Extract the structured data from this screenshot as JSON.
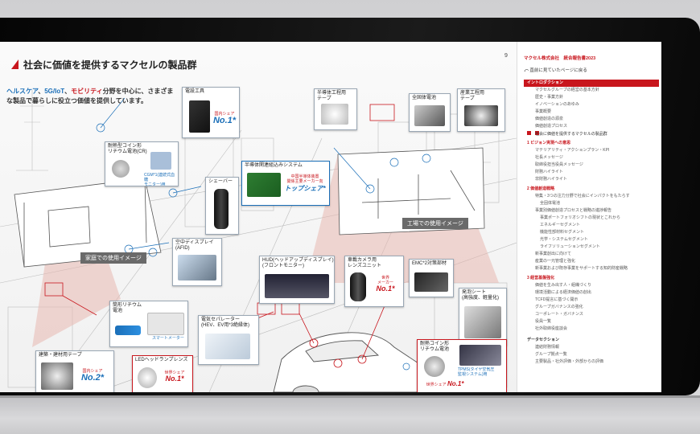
{
  "document": {
    "title": "社会に価値を提供するマクセルの製品群",
    "page_number": "9",
    "lead_before": "",
    "lead_hl1": "ヘルスケア",
    "lead_sep1": "、",
    "lead_hl2": "5G/IoT",
    "lead_sep2": "、",
    "lead_hl3": "モビリティ",
    "lead_after": "分野を中心に、さまざまな製品で暮らしに役立つ価値を提供しています。"
  },
  "labels": {
    "home": "家庭での使用イメージ",
    "factory": "工場での使用イメージ"
  },
  "products": {
    "drill": {
      "title": "電設工具",
      "share": "国内シェア",
      "rank": "No.1",
      "sup": "*"
    },
    "coin": {
      "title": "耐熱型コイン形\nリチウム電池(CR)",
      "note": "CGM*1(連続式血糖\nモニター)用"
    },
    "shaver": {
      "title": "シェーバー"
    },
    "semi_embed": {
      "title": "半導体関連組込みシステム",
      "share": "中国半導体装置\n関係主要メーカー向",
      "rank": "トップシェア",
      "sup": "*"
    },
    "semi_tape": {
      "title": "半導体工程用\nテープ"
    },
    "solid": {
      "title": "全固体電池"
    },
    "industrial_tape": {
      "title": "産業工程用\nテープ"
    },
    "aerial": {
      "title": "空中ディスプレイ\n(AFID)"
    },
    "hud": {
      "title": "HUD(ヘッドアップディスプレイ)\n(フロントモニター)"
    },
    "camera": {
      "title": "車載カメラ用\nレンズユニット",
      "share": "世界\nメーカー",
      "rank": "No.1",
      "sup": "*"
    },
    "emc": {
      "title": "EMC*2対策部材"
    },
    "cylinder": {
      "title": "筒形リチウム\n電池",
      "meter": "スマートメーター"
    },
    "heat_sheet": {
      "title": "発泡シート\n(高強度、軽量化)"
    },
    "separator": {
      "title": "電気セパレーター\n(HEV、EV用*3絶縁体)"
    },
    "led": {
      "title": "LEDヘッドランプレンズ",
      "share": "世界シェア",
      "rank": "No.1",
      "sup": "*"
    },
    "building_tape": {
      "title": "建築・建材用テープ",
      "share": "国内シェア",
      "rank": "No.2",
      "sup": "*"
    },
    "heat_coin": {
      "title": "耐熱コイン形\nリチウム電池",
      "note": "TPMS(タイヤ空気圧\n監視システム)用",
      "share": "世界シェア",
      "rank": "No.1",
      "sup": "*"
    }
  },
  "sidebar": {
    "header": "マクセル株式会社　統合報告書2023",
    "back": "直前に見ていたページに戻る",
    "items": [
      {
        "label": "イントロダクション",
        "kind": "sec on"
      },
      {
        "label": "マクセルグループの経営の基本方針",
        "kind": ""
      },
      {
        "label": "歴史・事業方針",
        "kind": ""
      },
      {
        "label": "イノベーションのあゆみ",
        "kind": ""
      },
      {
        "label": "事業概要",
        "kind": ""
      },
      {
        "label": "価値創造の源泉",
        "kind": ""
      },
      {
        "label": "価値創造プロセス",
        "kind": ""
      },
      {
        "label": "社会に価値を提供するマクセルの製品群",
        "kind": "cur"
      },
      {
        "label": "1 ビジョン実現への意思",
        "kind": "sec"
      },
      {
        "label": "マテリアリティ・アクションプラン・KPI",
        "kind": ""
      },
      {
        "label": "社長メッセージ",
        "kind": ""
      },
      {
        "label": "取締役担当役員メッセージ",
        "kind": ""
      },
      {
        "label": "財務ハイライト",
        "kind": ""
      },
      {
        "label": "非財務ハイライト",
        "kind": ""
      },
      {
        "label": "2 価値創造戦略",
        "kind": "sec"
      },
      {
        "label": "特集・3つの注力分野で社会にインパクトをもたらす",
        "kind": ""
      },
      {
        "label": "全固体電池",
        "kind": "sub"
      },
      {
        "label": "事業別価値創造プロセスと戦略の進捗報告",
        "kind": ""
      },
      {
        "label": "事業ポートフォリオシフトの現状とこれから",
        "kind": "sub"
      },
      {
        "label": "エネルギーセグメント",
        "kind": "sub"
      },
      {
        "label": "機能性部材料セグメント",
        "kind": "sub"
      },
      {
        "label": "光学・システムセグメント",
        "kind": "sub"
      },
      {
        "label": "ライフソリューションセグメント",
        "kind": "sub"
      },
      {
        "label": "新事業創出に向けて",
        "kind": ""
      },
      {
        "label": "産業の一元管理と強化",
        "kind": ""
      },
      {
        "label": "新事業および既存事業をサポートする知的財産戦略",
        "kind": ""
      },
      {
        "label": "3 経営基盤強化",
        "kind": "sec"
      },
      {
        "label": "価値を生み出す人・組織づくり",
        "kind": ""
      },
      {
        "label": "環境活動による経済価値の創出",
        "kind": ""
      },
      {
        "label": "TCFD提言に基づく開示",
        "kind": ""
      },
      {
        "label": "グループガバナンスの強化",
        "kind": ""
      },
      {
        "label": "コーポレート・ガバナンス",
        "kind": ""
      },
      {
        "label": "役員一覧",
        "kind": ""
      },
      {
        "label": "社外取締役座談会",
        "kind": ""
      },
      {
        "label": "データセクション",
        "kind": "plain"
      },
      {
        "label": "連結財務情報",
        "kind": ""
      },
      {
        "label": "グループ拠点一覧",
        "kind": ""
      },
      {
        "label": "主要製品・社外評価・外部からの評価",
        "kind": ""
      }
    ]
  },
  "colors": {
    "accent": "#c8161d",
    "blue": "#1b6fb8",
    "label_bg": "#6a6a6a"
  }
}
